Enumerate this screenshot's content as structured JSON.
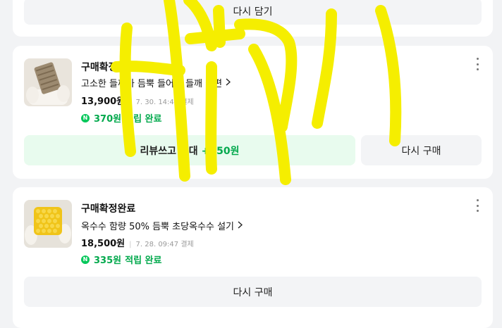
{
  "top_card": {
    "button_label": "다시 담기"
  },
  "orders": [
    {
      "status": "구매확정완료",
      "product_name": "고소한 들깨가 듬뿍 들어간 들깨 절편",
      "price": "13,900원",
      "date": "7. 30. 14:45 결제",
      "points_amount": "370원",
      "points_label": "적립 완료",
      "review_button": {
        "prefix": "리뷰쓰고 최대",
        "amount": "+150원"
      },
      "rebuy_label": "다시 구매"
    },
    {
      "status": "구매확정완료",
      "product_name": "옥수수 함량 50% 듬뿍 초당옥수수 설기",
      "price": "18,500원",
      "date": "7. 28. 09:47 결제",
      "points_amount": "335원",
      "points_label": "적립 완료",
      "rebuy_label": "다시 구매"
    }
  ],
  "icons": {
    "more": "more-vertical-icon",
    "chevron": "chevron-right-icon",
    "naver_point": "naver-point-icon"
  },
  "colors": {
    "green": "#03c75a",
    "review_bg": "#e8fbee",
    "highlight": "#f5ee00"
  }
}
